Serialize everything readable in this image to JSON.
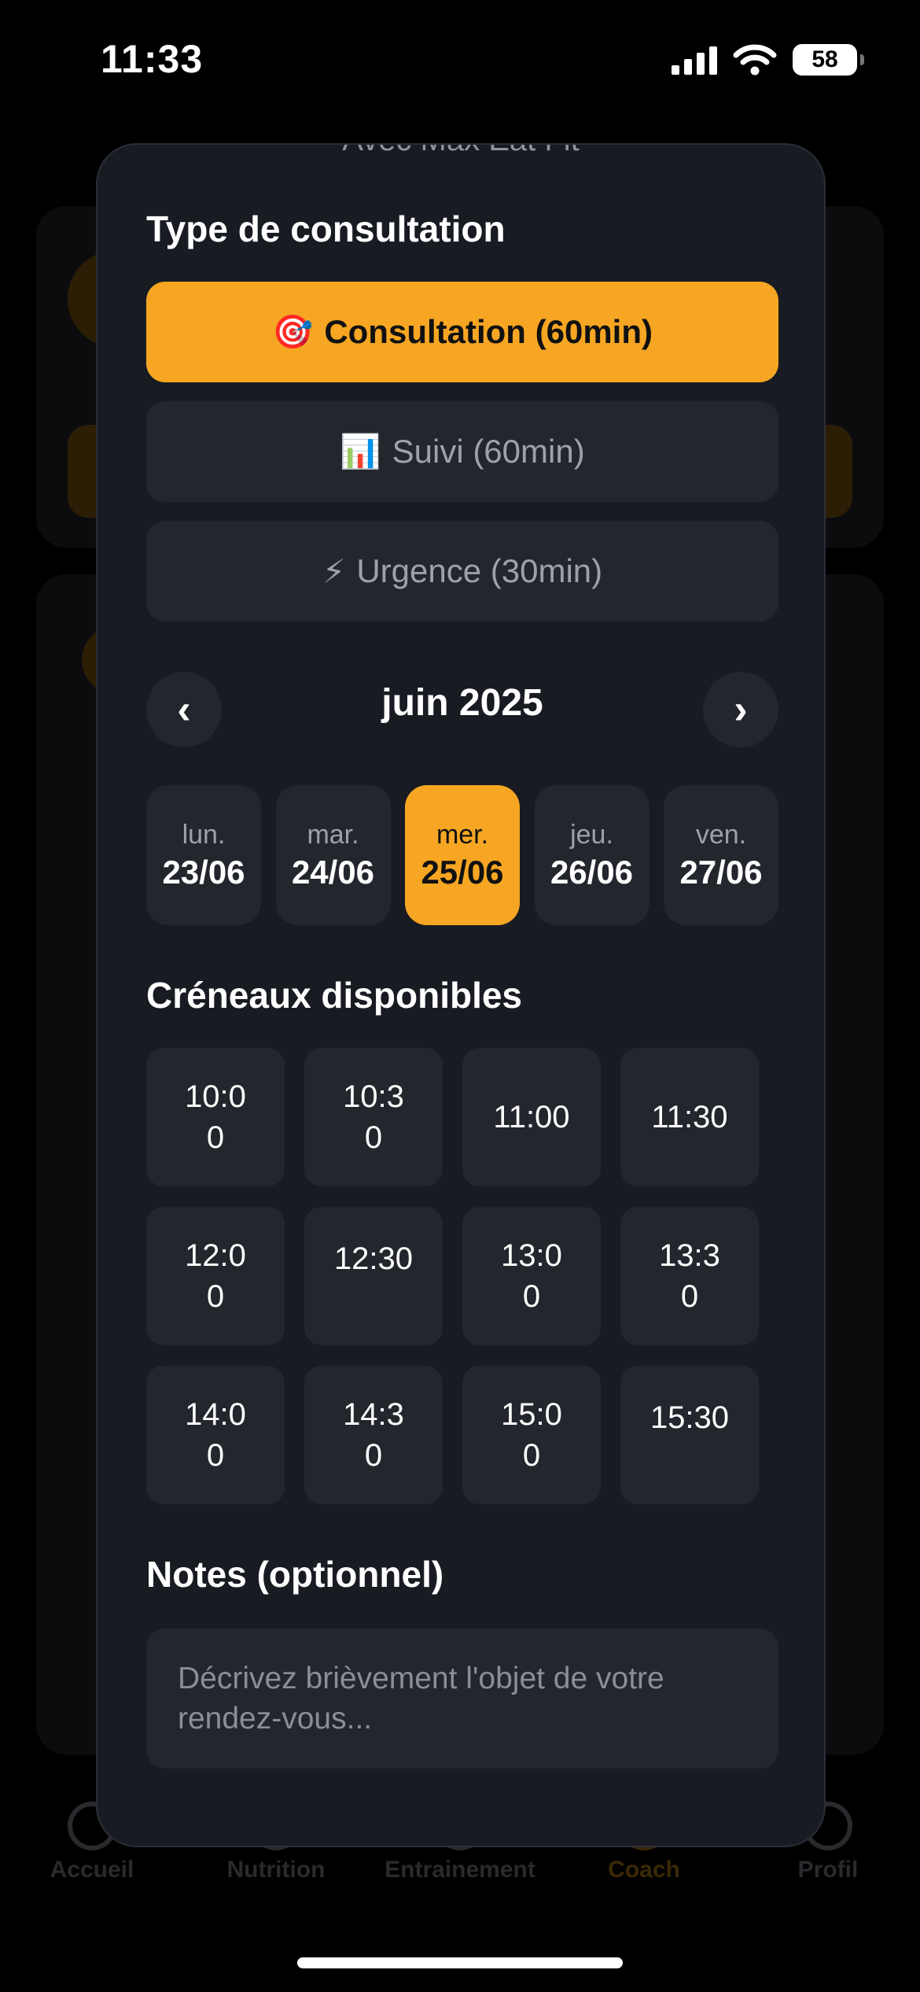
{
  "status_bar": {
    "time": "11:33",
    "battery": "58"
  },
  "background_app": {
    "nav": [
      {
        "label": "Accueil",
        "icon": "home-icon"
      },
      {
        "label": "Nutrition",
        "icon": "fork-knife-icon"
      },
      {
        "label": "Entrainement",
        "icon": "dumbbell-icon"
      },
      {
        "label": "Coach",
        "icon": "coach-icon"
      },
      {
        "label": "Profil",
        "icon": "profile-icon"
      }
    ]
  },
  "modal": {
    "subtitle": "Avec Max Eat Fit",
    "type_title": "Type de consultation",
    "types": [
      {
        "emoji": "🎯",
        "label": "Consultation (60min)",
        "selected": true
      },
      {
        "emoji": "📊",
        "label": "Suivi (60min)",
        "selected": false
      },
      {
        "emoji": "⚡",
        "label": "Urgence (30min)",
        "selected": false
      }
    ],
    "calendar": {
      "prev_label": "‹",
      "next_label": "›",
      "month": "juin 2025",
      "days": [
        {
          "name": "lun.",
          "date": "23/06",
          "selected": false
        },
        {
          "name": "mar.",
          "date": "24/06",
          "selected": false
        },
        {
          "name": "mer.",
          "date": "25/06",
          "selected": true
        },
        {
          "name": "jeu.",
          "date": "26/06",
          "selected": false
        },
        {
          "name": "ven.",
          "date": "27/06",
          "selected": false
        }
      ]
    },
    "slots_title": "Créneaux disponibles",
    "slots": [
      "10:00",
      "10:30",
      "11:00",
      "11:30",
      "12:00",
      "12:30",
      "13:00",
      "13:30",
      "14:00",
      "14:30",
      "15:00",
      "15:30"
    ],
    "notes_title": "Notes (optionnel)",
    "notes_placeholder": "Décrivez brièvement l'objet de votre rendez-vous..."
  },
  "colors": {
    "accent": "#F6A623",
    "modal_bg": "#181B21",
    "button_bg": "#23262D"
  }
}
